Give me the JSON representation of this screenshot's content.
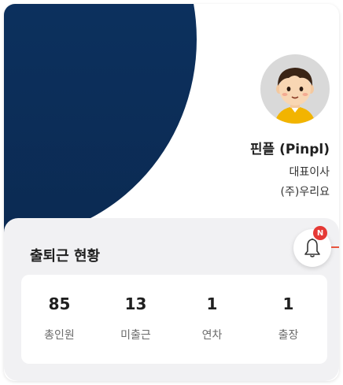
{
  "profile": {
    "name": "핀플 (Pinpl)",
    "title": "대표이사",
    "company": "(주)우리요"
  },
  "attendance": {
    "title": "출퇴근 현황",
    "notification_badge": "N",
    "stats": [
      {
        "value": "85",
        "label": "총인원"
      },
      {
        "value": "13",
        "label": "미출근"
      },
      {
        "value": "1",
        "label": "연차"
      },
      {
        "value": "1",
        "label": "출장"
      }
    ]
  },
  "colors": {
    "hero": "#0d3566",
    "badge": "#e53935",
    "panel_bg": "#f1f1f3"
  },
  "icons": {
    "avatar": "avatar-illustration",
    "notifications": "bell-icon"
  }
}
